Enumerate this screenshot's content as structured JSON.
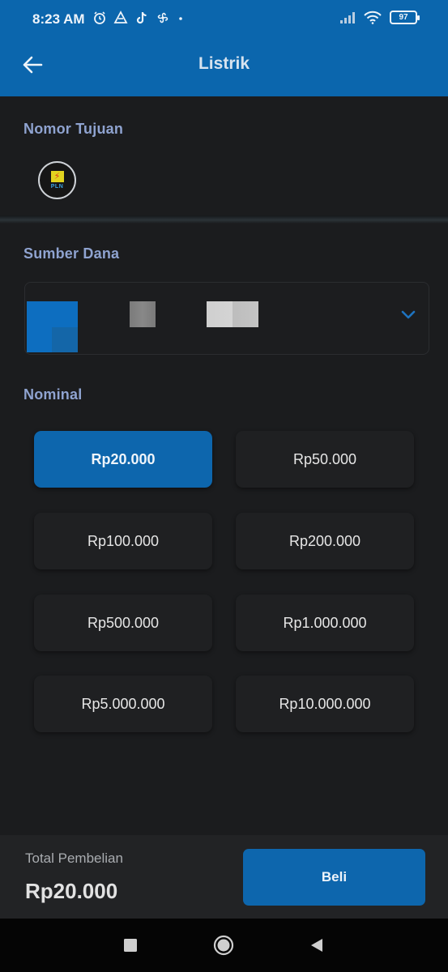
{
  "status_bar": {
    "time": "8:23 AM",
    "battery": "97",
    "notification_icons": [
      "alarm-icon",
      "drive-icon",
      "tiktok-icon",
      "pinwheel-icon",
      "dot-icon"
    ],
    "system_icons": [
      "signal-icon",
      "wifi-icon",
      "battery-icon"
    ]
  },
  "header": {
    "title": "Listrik",
    "back_icon": "arrow-left-icon",
    "background_color": "#0b66ad"
  },
  "target": {
    "label": "Nomor Tujuan",
    "provider_logo_text": "PLN"
  },
  "funding": {
    "label": "Sumber Dana",
    "dropdown_icon": "chevron-down-icon"
  },
  "nominal": {
    "label": "Nominal",
    "selected_index": 0,
    "options": [
      "Rp20.000",
      "Rp50.000",
      "Rp100.000",
      "Rp200.000",
      "Rp500.000",
      "Rp1.000.000",
      "Rp5.000.000",
      "Rp10.000.000"
    ]
  },
  "footer": {
    "total_label": "Total Pembelian",
    "total_value": "Rp20.000",
    "buy_label": "Beli"
  },
  "navigation": [
    "recents-square-icon",
    "home-circle-icon",
    "back-triangle-icon"
  ],
  "colors": {
    "accent": "#0d66ad",
    "background": "#1b1c1e",
    "section_label": "#8fa3d0"
  }
}
